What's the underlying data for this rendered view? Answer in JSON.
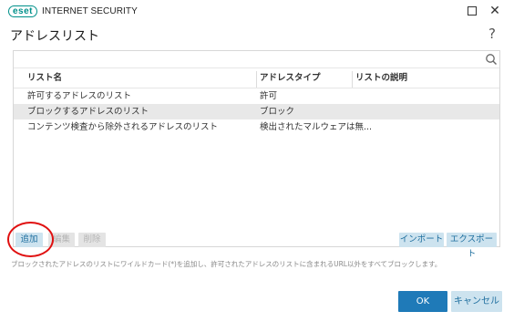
{
  "app": {
    "logo_text": "eset",
    "product_name": "INTERNET SECURITY"
  },
  "dialog": {
    "title": "アドレスリスト",
    "help": "?"
  },
  "table": {
    "columns": [
      "リスト名",
      "アドレスタイプ",
      "リストの説明"
    ],
    "rows": [
      {
        "name": "許可するアドレスのリスト",
        "type": "許可",
        "description": ""
      },
      {
        "name": "ブロックするアドレスのリスト",
        "type": "ブロック",
        "description": ""
      },
      {
        "name": "コンテンツ検査から除外されるアドレスのリスト",
        "type": "検出されたマルウェアは無...",
        "description": ""
      }
    ],
    "selected_row": 1
  },
  "buttons": {
    "add": "追加",
    "edit": "編集",
    "delete": "削除",
    "import": "インポート",
    "export": "エクスポート",
    "ok": "OK",
    "cancel": "キャンセル"
  },
  "info": "ブロックされたアドレスのリストにワイルドカード(*)を追加し、許可されたアドレスのリストに含まれるURL以外をすべてブロックします。",
  "colors": {
    "brand": "#00908a",
    "accent": "#1f7ab8",
    "secondary_button": "#cde3ef",
    "highlight": "#e01010"
  }
}
